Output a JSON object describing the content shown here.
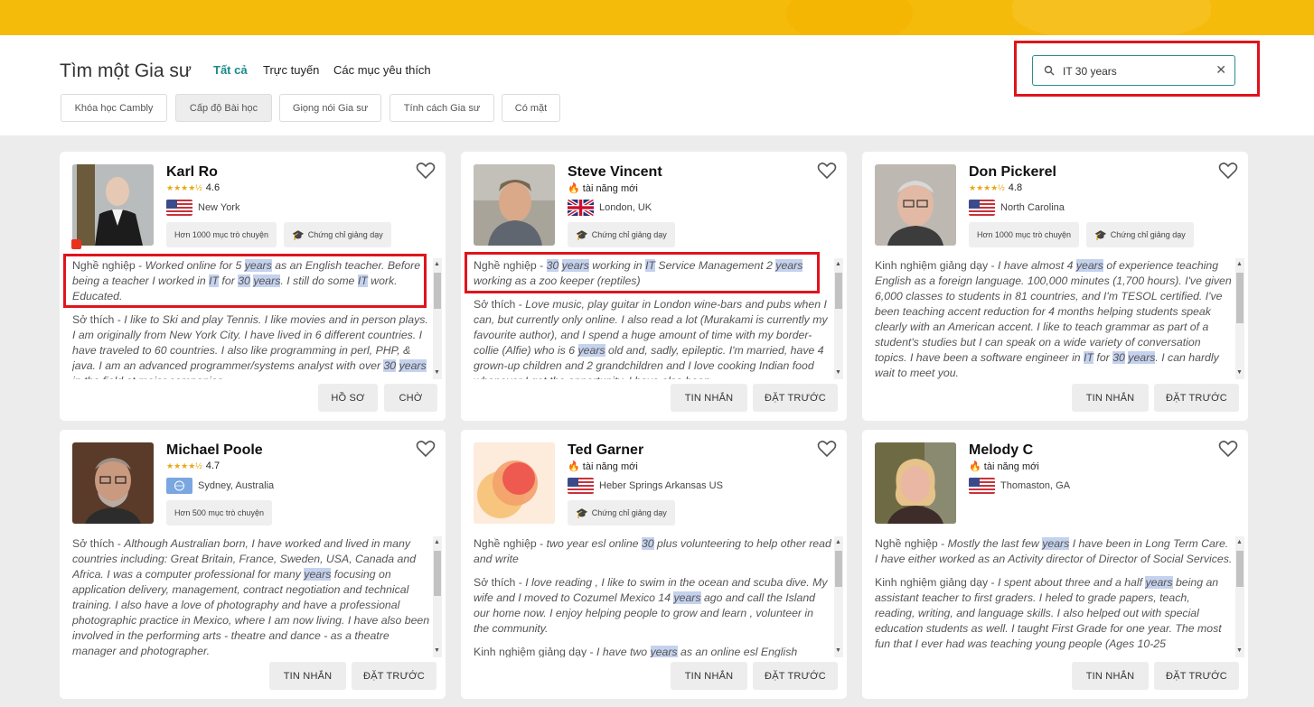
{
  "header": {
    "title": "Tìm một Gia sư",
    "tabs": [
      "Tất cả",
      "Trực tuyến",
      "Các mục yêu thích"
    ],
    "filters": [
      "Khóa học Cambly",
      "Cấp độ Bài học",
      "Giọng nói Gia sư",
      "Tính cách Gia sư",
      "Có mặt"
    ]
  },
  "search": {
    "value": "IT 30 years",
    "icon": "search-icon",
    "clear_icon": "close-icon"
  },
  "colors": {
    "banner": "#f5bb0a",
    "accent": "#1b8a8a",
    "highlight": "#c5d2ee",
    "annotation": "#e0141c"
  },
  "tutors": [
    {
      "name": "Karl Ro",
      "rating": "4.6",
      "stars": "★★★★½",
      "location": "New York",
      "flag": "us",
      "badges": [
        "Hơn 1000 mục trò chuyện",
        "Chứng chỉ giảng dạy"
      ],
      "buttons": [
        "HỒ SƠ",
        "CHỜ"
      ]
    },
    {
      "name": "Steve Vincent",
      "new_talent": "tài năng mới",
      "location": "London, UK",
      "flag": "uk",
      "badges": [
        "Chứng chỉ giảng dạy"
      ],
      "buttons": [
        "TIN NHẮN",
        "ĐẶT TRƯỚC"
      ]
    },
    {
      "name": "Don Pickerel",
      "rating": "4.8",
      "stars": "★★★★½",
      "location": "North Carolina",
      "flag": "us",
      "badges": [
        "Hơn 1000 mục trò chuyện",
        "Chứng chỉ giảng dạy"
      ],
      "buttons": [
        "TIN NHẮN",
        "ĐẶT TRƯỚC"
      ]
    },
    {
      "name": "Michael Poole",
      "rating": "4.7",
      "stars": "★★★★½",
      "location": "Sydney, Australia",
      "flag": "un",
      "badges": [
        "Hơn 500 mục trò chuyện"
      ],
      "buttons": [
        "TIN NHẮN",
        "ĐẶT TRƯỚC"
      ]
    },
    {
      "name": "Ted Garner",
      "new_talent": "tài năng mới",
      "location": "Heber Springs Arkansas US",
      "flag": "us",
      "badges": [
        "Chứng chỉ giảng dạy"
      ],
      "buttons": [
        "TIN NHẮN",
        "ĐẶT TRƯỚC"
      ]
    },
    {
      "name": "Melody C",
      "new_talent": "tài năng mới",
      "location": "Thomaston, GA",
      "flag": "us",
      "badges": [],
      "buttons": [
        "TIN NHẮN",
        "ĐẶT TRƯỚC"
      ]
    }
  ],
  "labels": {
    "occupation": "Nghề nghiệp - ",
    "hobby": "Sở thích - ",
    "teaching": "Kinh nghiệm giảng dạy - "
  },
  "desc": {
    "c1p1": [
      [
        "t",
        "Worked online for 5 "
      ],
      [
        "h",
        "years"
      ],
      [
        "t",
        " as an English teacher. Before being a teacher I worked in "
      ],
      [
        "h",
        "IT"
      ],
      [
        "t",
        " for "
      ],
      [
        "h",
        "30"
      ],
      [
        "t",
        " "
      ],
      [
        "h",
        "years"
      ],
      [
        "t",
        ". I still do some "
      ],
      [
        "h",
        "IT"
      ],
      [
        "t",
        " work. Educated."
      ]
    ],
    "c1p2": [
      [
        "t",
        "I like to Ski and play Tennis. I like movies and in person plays. I am originally from New York City. I have lived in 6 different countries. I have traveled to 60 countries. I also like programming in perl, PHP, & java. I am an advanced programmer/systems analyst with over "
      ],
      [
        "h",
        "30"
      ],
      [
        "t",
        " "
      ],
      [
        "h",
        "years"
      ],
      [
        "t",
        " in the field at major companies."
      ]
    ],
    "c2p1": [
      [
        "h",
        "30"
      ],
      [
        "t",
        " "
      ],
      [
        "h",
        "years"
      ],
      [
        "t",
        " working in "
      ],
      [
        "h",
        "IT"
      ],
      [
        "t",
        " Service Management 2 "
      ],
      [
        "h",
        "years"
      ],
      [
        "t",
        " working as a zoo keeper (reptiles)"
      ]
    ],
    "c2p2": [
      [
        "t",
        "Love music, play guitar in London wine-bars and pubs when I can, but currently only online. I also read a lot (Murakami is currently my favourite author), and I spend a huge amount of time with my border-collie (Alfie) who is 6 "
      ],
      [
        "h",
        "years"
      ],
      [
        "t",
        " old and, sadly, epileptic. I'm married, have 4 grown-up children and 2 grandchildren and I love cooking Indian food whenever I get the opportunity. I have also been"
      ]
    ],
    "c3p1": [
      [
        "t",
        "I have almost 4 "
      ],
      [
        "h",
        "years"
      ],
      [
        "t",
        " of experience teaching English as a foreign language. 100,000 minutes (1,700 hours). I've given 6,000 classes to students in 81 countries, and I'm TESOL certified. I've been teaching accent reduction for 4 months helping students speak clearly with an American accent. I like to teach grammar as part of a student's studies but I can speak on a wide variety of conversation topics. I have been a software engineer in "
      ],
      [
        "h",
        "IT"
      ],
      [
        "t",
        " for "
      ],
      [
        "h",
        "30"
      ],
      [
        "t",
        " "
      ],
      [
        "h",
        "years"
      ],
      [
        "t",
        ". I can hardly wait to meet you."
      ]
    ],
    "c4p1": [
      [
        "t",
        "Although Australian born, I have worked and lived in many countries including: Great Britain, France, Sweden, USA, Canada and Africa. I was a computer professional for many "
      ],
      [
        "h",
        "years"
      ],
      [
        "t",
        " focusing on application delivery, management, contract negotiation and technical training. I also have a love of photography and have a professional photographic practice in Mexico, where I am now living. I have also been involved in the performing arts - theatre and dance - as a theatre manager and photographer."
      ]
    ],
    "c5p1": [
      [
        "t",
        "two year esl online "
      ],
      [
        "h",
        "30"
      ],
      [
        "t",
        " plus volunteering to help other read and write"
      ]
    ],
    "c5p2": [
      [
        "t",
        "I love reading , I like to swim in the ocean and scuba dive. My wife and I moved to Cozumel Mexico 14 "
      ],
      [
        "h",
        "years"
      ],
      [
        "t",
        " ago and call the Island our home now. I enjoy helping people to grow and learn , volunteer in the community."
      ]
    ],
    "c5p3": [
      [
        "t",
        "I have two "
      ],
      [
        "h",
        "years"
      ],
      [
        "t",
        " as an online esl English teacher."
      ]
    ],
    "c6p1": [
      [
        "t",
        "Mostly the last few "
      ],
      [
        "h",
        "years"
      ],
      [
        "t",
        " I have been in Long Term Care. I have either worked as an Activity director of Director of Social Services."
      ]
    ],
    "c6p2": [
      [
        "t",
        "I spent about three and a half "
      ],
      [
        "h",
        "years"
      ],
      [
        "t",
        " being an assistant teacher to first graders. I heled to grade papers, teach, reading, writing, and language skills. I also helped out with special education students as well. I taught First Grade for one year. The most fun that I ever had was teaching young people (Ages 10-25"
      ]
    ]
  }
}
